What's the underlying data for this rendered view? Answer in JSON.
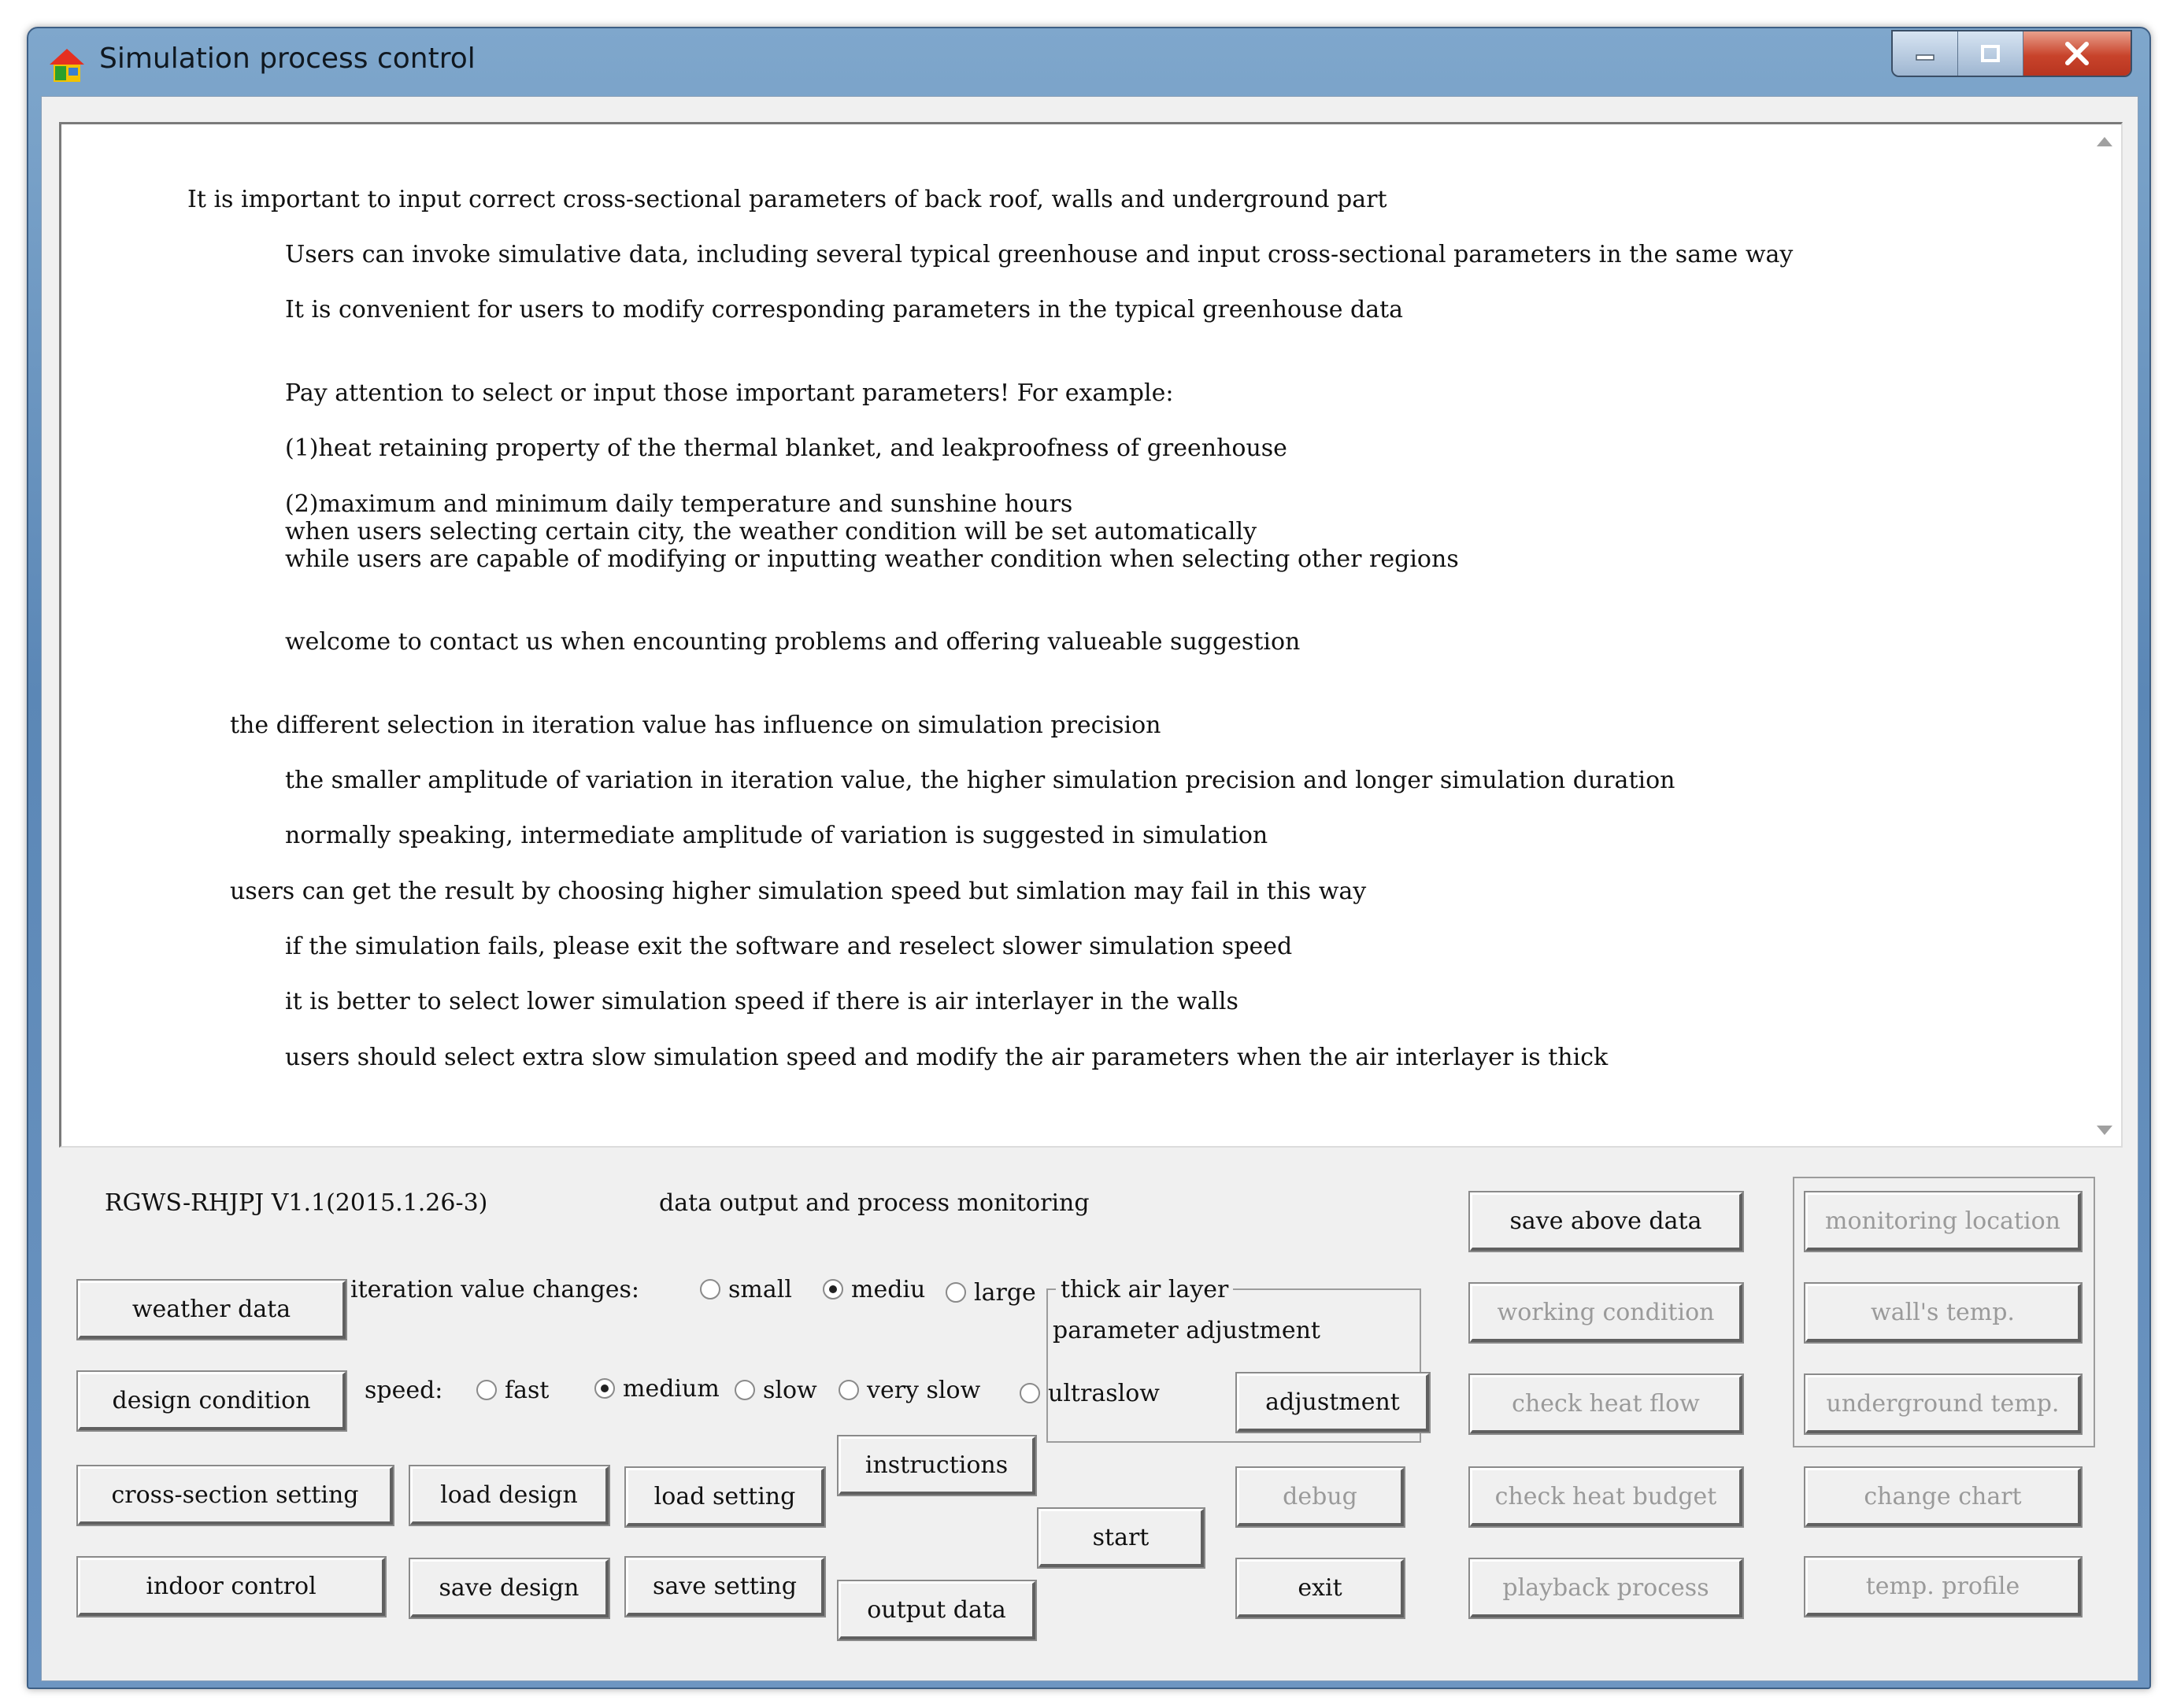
{
  "window": {
    "title": "Simulation process control"
  },
  "info_lines": [
    "It is important to input correct cross-sectional parameters of back roof, walls and underground part",
    "Users can invoke simulative data, including several typical greenhouse and input cross-sectional parameters in the same way",
    "It is convenient for users to modify corresponding parameters in the typical greenhouse data",
    "Pay attention to select or input those important parameters! For example:",
    "(1)heat retaining property of the thermal blanket, and leakproofness of greenhouse",
    "(2)maximum and minimum daily temperature and sunshine hours",
    "when users selecting certain city, the weather condition will be set automatically",
    "while users are capable of modifying or inputting weather condition when selecting other regions",
    "welcome to contact us when encounting problems and offering valueable suggestion",
    "the different selection in iteration value has influence on simulation precision",
    "the smaller amplitude of variation in iteration value, the higher simulation precision and longer simulation duration",
    "normally speaking, intermediate amplitude of variation is suggested in simulation",
    "users can get the result by choosing higher simulation speed but simlation may fail in this way",
    "if the simulation fails, please exit the software and reselect slower simulation speed",
    "it is better to select lower simulation speed if there is air interlayer in the walls",
    "users should select extra slow simulation speed and modify the air parameters when the air interlayer is thick"
  ],
  "labels": {
    "version": "RGWS-RHJPJ V1.1(2015.1.26-3)",
    "monitor": "data output and process monitoring",
    "iteration": "iteration value changes:",
    "speed": "speed:",
    "group_title": "thick air layer",
    "param_adjust": "parameter adjustment"
  },
  "iteration_options": [
    "small",
    "mediu",
    "large"
  ],
  "iteration_selected": "mediu",
  "speed_options": [
    "fast",
    "medium",
    "slow",
    "very slow",
    "ultraslow"
  ],
  "speed_selected": "medium",
  "buttons": {
    "weather_data": "weather data",
    "design_condition": "design condition",
    "cross_section_setting": "cross-section setting",
    "indoor_control": "indoor control",
    "load_design": "load design",
    "save_design": "save design",
    "load_setting": "load setting",
    "save_setting": "save setting",
    "instructions": "instructions",
    "output_data": "output data",
    "start": "start",
    "adjustment": "adjustment",
    "debug": "debug",
    "exit": "exit",
    "save_above_data": "save above data",
    "working_condition": "working condition",
    "check_heat_flow": "check heat flow",
    "check_heat_budget": "check heat budget",
    "playback_process": "playback process",
    "monitoring_location": "monitoring location",
    "walls_temp": "wall's temp.",
    "underground_temp": "underground temp.",
    "change_chart": "change chart",
    "temp_profile": "temp. profile"
  }
}
